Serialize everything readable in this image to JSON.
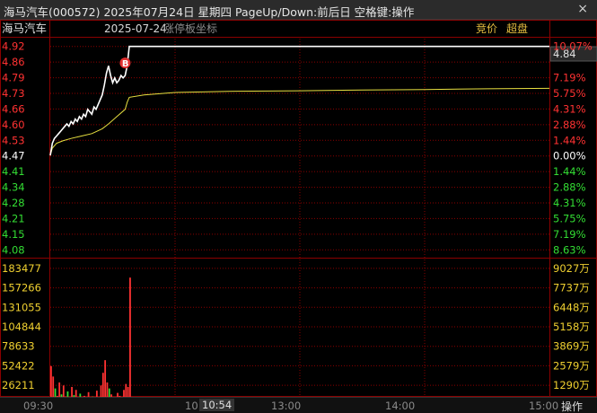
{
  "window": {
    "title": "海马汽车(000572) 2025年07月24日 星期四 PageUp/Down:前后日 空格键:操作",
    "close_glyph": "×"
  },
  "chart_header": {
    "stock_name": "海马汽车",
    "date": "2025-07-24",
    "mode": "涨停板坐标",
    "btn_auction": "竞价",
    "btn_superboard": "超盘",
    "current_price_box": "4.84"
  },
  "colors": {
    "up": "#ff3232",
    "down": "#33dd33",
    "neutral": "#ffffff",
    "avg_line": "#e8e040",
    "grid": "#8b0000",
    "volume_label": "#f0d030",
    "price_line": "#ffffff"
  },
  "chart_data": {
    "type": "line",
    "price_labels_left": [
      "4.92",
      "4.86",
      "4.79",
      "4.73",
      "4.66",
      "4.60",
      "4.53",
      "4.47",
      "4.41",
      "4.34",
      "4.28",
      "4.21",
      "4.15",
      "4.08"
    ],
    "pct_labels_right": [
      "10.07%",
      "",
      "7.19%",
      "5.75%",
      "4.31%",
      "2.88%",
      "1.44%",
      "0.00%",
      "1.44%",
      "2.88%",
      "4.31%",
      "5.75%",
      "7.19%",
      "8.63%"
    ],
    "ylim": [
      4.08,
      4.92
    ],
    "prev_close": 4.47,
    "volume_labels_left": [
      "183477",
      "157266",
      "131055",
      "104844",
      "78633",
      "52422",
      "26211"
    ],
    "amount_labels_right": [
      "9027万",
      "7737万",
      "6448万",
      "5158万",
      "3869万",
      "2579万",
      "1290万"
    ],
    "volume_max": 183477,
    "x_labels": [
      "09:30",
      "10:30",
      "10:54",
      "13:00",
      "14:00",
      "15:00"
    ],
    "x_label_active": "10:54",
    "total_minutes": 240,
    "price_series": [
      [
        0,
        4.47
      ],
      [
        1,
        4.52
      ],
      [
        2,
        4.54
      ],
      [
        3,
        4.55
      ],
      [
        4,
        4.56
      ],
      [
        5,
        4.57
      ],
      [
        6,
        4.58
      ],
      [
        7,
        4.59
      ],
      [
        8,
        4.6
      ],
      [
        9,
        4.59
      ],
      [
        10,
        4.61
      ],
      [
        11,
        4.6
      ],
      [
        12,
        4.62
      ],
      [
        13,
        4.61
      ],
      [
        14,
        4.63
      ],
      [
        15,
        4.62
      ],
      [
        16,
        4.64
      ],
      [
        17,
        4.63
      ],
      [
        18,
        4.66
      ],
      [
        19,
        4.65
      ],
      [
        20,
        4.64
      ],
      [
        21,
        4.67
      ],
      [
        22,
        4.66
      ],
      [
        23,
        4.68
      ],
      [
        24,
        4.7
      ],
      [
        25,
        4.72
      ],
      [
        26,
        4.76
      ],
      [
        27,
        4.81
      ],
      [
        28,
        4.84
      ],
      [
        29,
        4.8
      ],
      [
        30,
        4.77
      ],
      [
        31,
        4.79
      ],
      [
        32,
        4.77
      ],
      [
        33,
        4.78
      ],
      [
        34,
        4.8
      ],
      [
        35,
        4.79
      ],
      [
        36,
        4.8
      ],
      [
        37,
        4.84
      ],
      [
        38,
        4.92
      ],
      [
        240,
        4.92
      ]
    ],
    "avg_series": [
      [
        0,
        4.47
      ],
      [
        1,
        4.5
      ],
      [
        3,
        4.52
      ],
      [
        6,
        4.53
      ],
      [
        10,
        4.54
      ],
      [
        15,
        4.55
      ],
      [
        20,
        4.56
      ],
      [
        25,
        4.58
      ],
      [
        28,
        4.6
      ],
      [
        32,
        4.63
      ],
      [
        36,
        4.66
      ],
      [
        37,
        4.69
      ],
      [
        38,
        4.71
      ],
      [
        45,
        4.72
      ],
      [
        60,
        4.73
      ],
      [
        90,
        4.735
      ],
      [
        120,
        4.737
      ],
      [
        150,
        4.74
      ],
      [
        180,
        4.742
      ],
      [
        210,
        4.745
      ],
      [
        240,
        4.747
      ]
    ],
    "volume_bars": [
      [
        0,
        52000,
        "up"
      ],
      [
        1,
        38000,
        "up"
      ],
      [
        2,
        22000,
        "down"
      ],
      [
        3,
        12000,
        "up"
      ],
      [
        4,
        30000,
        "up"
      ],
      [
        5,
        14000,
        "down"
      ],
      [
        6,
        26000,
        "up"
      ],
      [
        7,
        11000,
        "up"
      ],
      [
        8,
        18000,
        "down"
      ],
      [
        9,
        9000,
        "up"
      ],
      [
        10,
        24000,
        "up"
      ],
      [
        11,
        13000,
        "down"
      ],
      [
        12,
        20000,
        "up"
      ],
      [
        13,
        10000,
        "up"
      ],
      [
        14,
        15000,
        "down"
      ],
      [
        15,
        8000,
        "up"
      ],
      [
        16,
        12000,
        "up"
      ],
      [
        17,
        9000,
        "down"
      ],
      [
        18,
        17000,
        "up"
      ],
      [
        19,
        7000,
        "up"
      ],
      [
        20,
        11000,
        "down"
      ],
      [
        21,
        6000,
        "up"
      ],
      [
        22,
        19000,
        "up"
      ],
      [
        23,
        8000,
        "up"
      ],
      [
        24,
        26000,
        "up"
      ],
      [
        25,
        43000,
        "up"
      ],
      [
        26,
        60000,
        "up"
      ],
      [
        27,
        30000,
        "up"
      ],
      [
        28,
        22000,
        "down"
      ],
      [
        29,
        14000,
        "up"
      ],
      [
        30,
        10000,
        "down"
      ],
      [
        31,
        8000,
        "up"
      ],
      [
        32,
        16000,
        "up"
      ],
      [
        33,
        12000,
        "up"
      ],
      [
        34,
        9000,
        "down"
      ],
      [
        35,
        20000,
        "up"
      ],
      [
        36,
        28000,
        "up"
      ],
      [
        37,
        24000,
        "up"
      ],
      [
        38,
        171000,
        "up"
      ],
      [
        39,
        8000,
        "neutral"
      ],
      [
        40,
        6000,
        "neutral"
      ],
      [
        41,
        5000,
        "neutral"
      ],
      [
        42,
        3000,
        "neutral"
      ],
      [
        44,
        4000,
        "neutral"
      ],
      [
        46,
        3000,
        "neutral"
      ],
      [
        48,
        2500,
        "neutral"
      ],
      [
        50,
        3000,
        "neutral"
      ],
      [
        52,
        2000,
        "neutral"
      ],
      [
        55,
        2000,
        "neutral"
      ],
      [
        58,
        1500,
        "neutral"
      ],
      [
        62,
        1500,
        "neutral"
      ],
      [
        66,
        1200,
        "neutral"
      ],
      [
        70,
        1200,
        "neutral"
      ],
      [
        75,
        1000,
        "neutral"
      ],
      [
        80,
        1000,
        "neutral"
      ],
      [
        90,
        800,
        "neutral"
      ],
      [
        100,
        800,
        "neutral"
      ],
      [
        110,
        700,
        "neutral"
      ],
      [
        120,
        700,
        "neutral"
      ],
      [
        135,
        700,
        "neutral"
      ],
      [
        150,
        600,
        "neutral"
      ],
      [
        165,
        600,
        "neutral"
      ],
      [
        180,
        500,
        "neutral"
      ],
      [
        195,
        9000,
        "neutral"
      ],
      [
        210,
        600,
        "neutral"
      ],
      [
        225,
        600,
        "neutral"
      ],
      [
        237,
        5000,
        "neutral"
      ],
      [
        239,
        1500,
        "neutral"
      ]
    ],
    "buy_marker": {
      "minute": 36,
      "price": 4.8,
      "label": "B"
    }
  },
  "footer": {
    "ops_label": "操作"
  }
}
